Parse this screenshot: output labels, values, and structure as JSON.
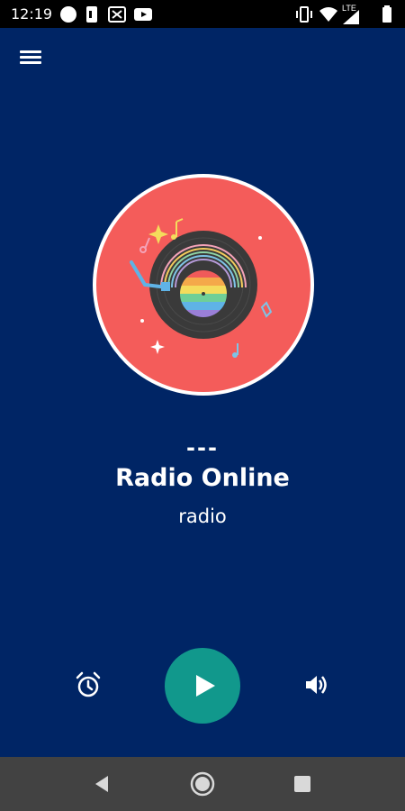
{
  "status_bar": {
    "time": "12:19",
    "network_label": "LTE",
    "icons": [
      "circle-notification-icon",
      "sim-icon",
      "gallery-icon",
      "youtube-icon",
      "vibrate-icon",
      "wifi-icon",
      "signal-icon",
      "battery-icon"
    ]
  },
  "app": {
    "menu_icon": "hamburger-menu-icon",
    "album_art": "vinyl-record-artwork",
    "separator": "---",
    "station_name": "Radio Online",
    "station_genre": "radio",
    "controls": [
      "alarm-clock-icon",
      "play-icon",
      "volume-icon"
    ]
  },
  "colors": {
    "background": "#002565",
    "album_circle": "#f45c5a",
    "play_button": "#11988c",
    "nav_bar": "#424242",
    "status_bar": "#000000"
  },
  "nav_bar": {
    "icons": [
      "back-icon",
      "home-icon",
      "recents-icon"
    ]
  }
}
